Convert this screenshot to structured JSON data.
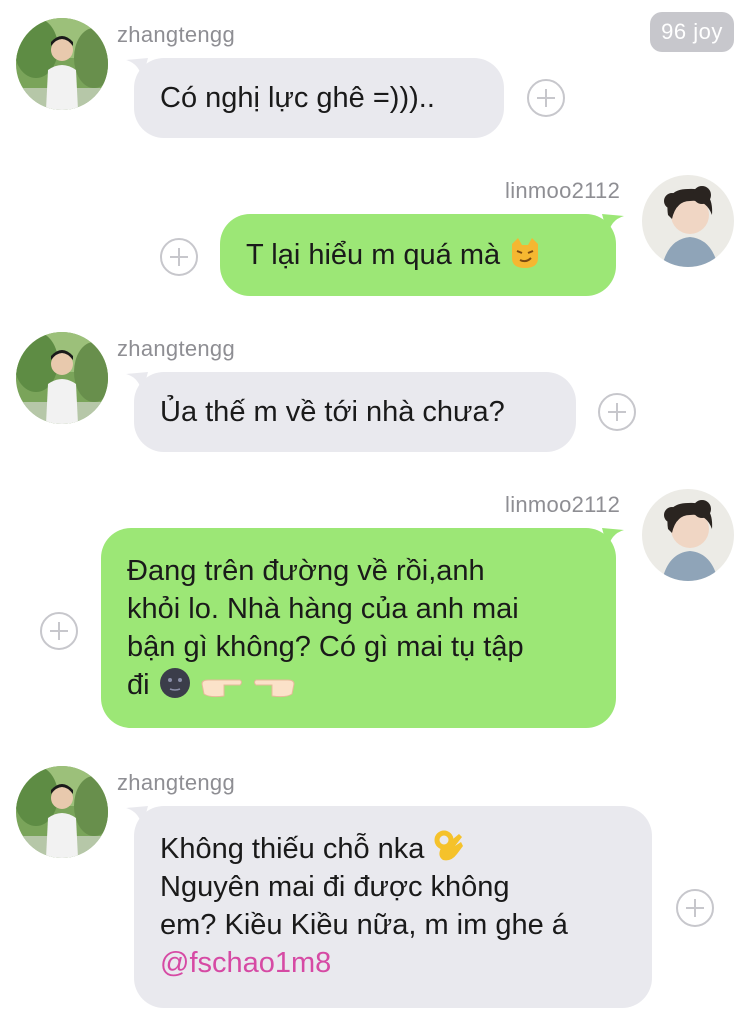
{
  "badge": {
    "label": "96 joy"
  },
  "messages": [
    {
      "sender": "zhangtengg",
      "direction": "incoming",
      "lines": [
        "Có nghị lực ghê =)))"
      ]
    },
    {
      "sender": "linmoo2112",
      "direction": "outgoing",
      "lines": [
        "T lại hiểu m quá mà"
      ],
      "emoji": "smirking-cat"
    },
    {
      "sender": "zhangtengg",
      "direction": "incoming",
      "lines": [
        "Ủa thế m về tới nhà chưa?"
      ]
    },
    {
      "sender": "linmoo2112",
      "direction": "outgoing",
      "lines": [
        "Đang trên đường về rồi,anh",
        "khỏi lo. Nhà hàng của anh mai",
        "bận gì không? Có gì mai tụ tập",
        "đi"
      ],
      "emoji": [
        "new-moon-face",
        "point-right",
        "point-left"
      ]
    },
    {
      "sender": "zhangtengg",
      "direction": "incoming",
      "lines": [
        "Không thiếu chỗ nka",
        "Nguyên mai đi được không",
        "em? Kiều Kiều nữa, m im ghe á"
      ],
      "mention": "@fschao1m8",
      "emoji": "ok-hand"
    }
  ],
  "colors": {
    "incoming_bubble": "#e9e9ee",
    "outgoing_bubble": "#9ce776",
    "mention": "#d64aa4",
    "badge_bg": "#c7c7cc"
  }
}
